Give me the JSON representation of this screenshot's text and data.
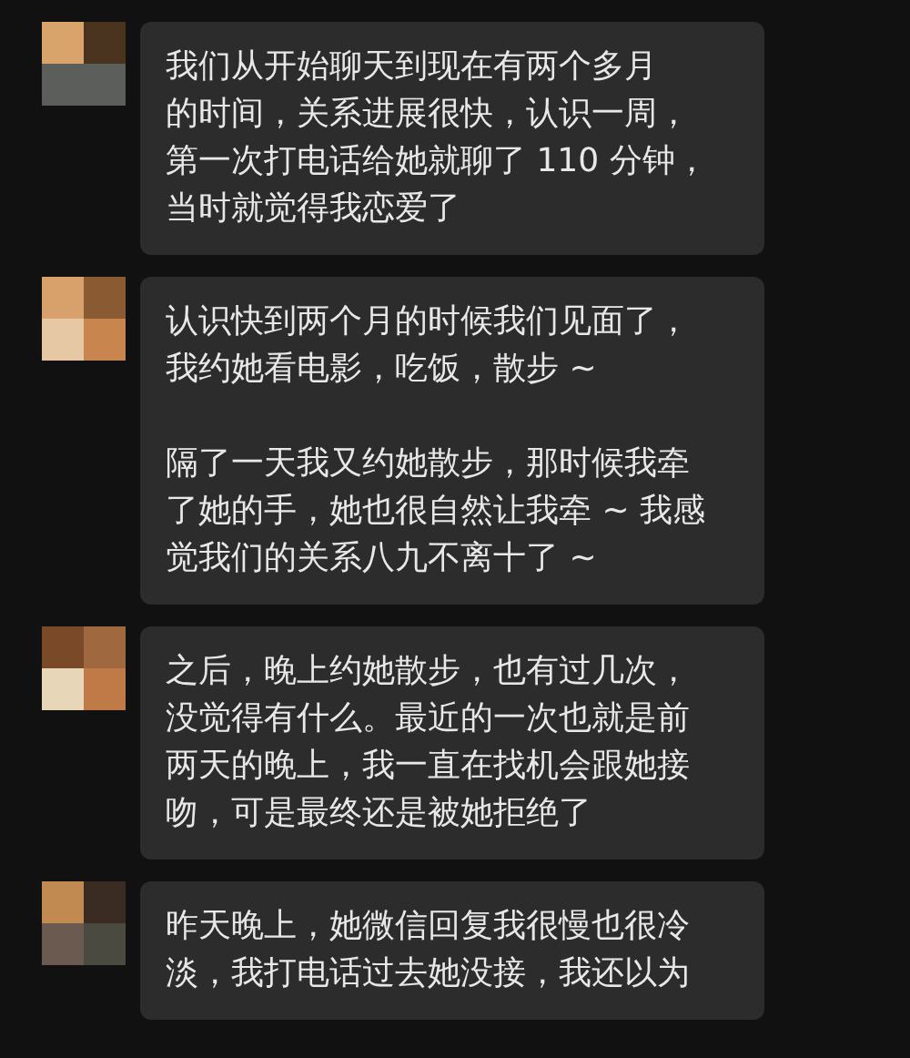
{
  "messages": [
    {
      "paragraphs": [
        [
          "我们从开始聊天到现在有两个多月",
          "的时间，关系进展很快，认识一周，",
          "第一次打电话给她就聊了 110 分钟，",
          "当时就觉得我恋爱了"
        ]
      ]
    },
    {
      "paragraphs": [
        [
          "认识快到两个月的时候我们见面了，",
          "我约她看电影，吃饭，散步 ~"
        ],
        [
          "隔了一天我又约她散步，那时候我牵",
          "了她的手，她也很自然让我牵 ~ 我感",
          "觉我们的关系八九不离十了 ~"
        ]
      ]
    },
    {
      "paragraphs": [
        [
          "之后，晚上约她散步，也有过几次，",
          "没觉得有什么。最近的一次也就是前",
          "两天的晚上，我一直在找机会跟她接",
          "吻，可是最终还是被她拒绝了"
        ]
      ]
    },
    {
      "paragraphs": [
        [
          "昨天晚上，她微信回复我很慢也很冷",
          "淡，我打电话过去她没接，我还以为"
        ]
      ]
    }
  ]
}
